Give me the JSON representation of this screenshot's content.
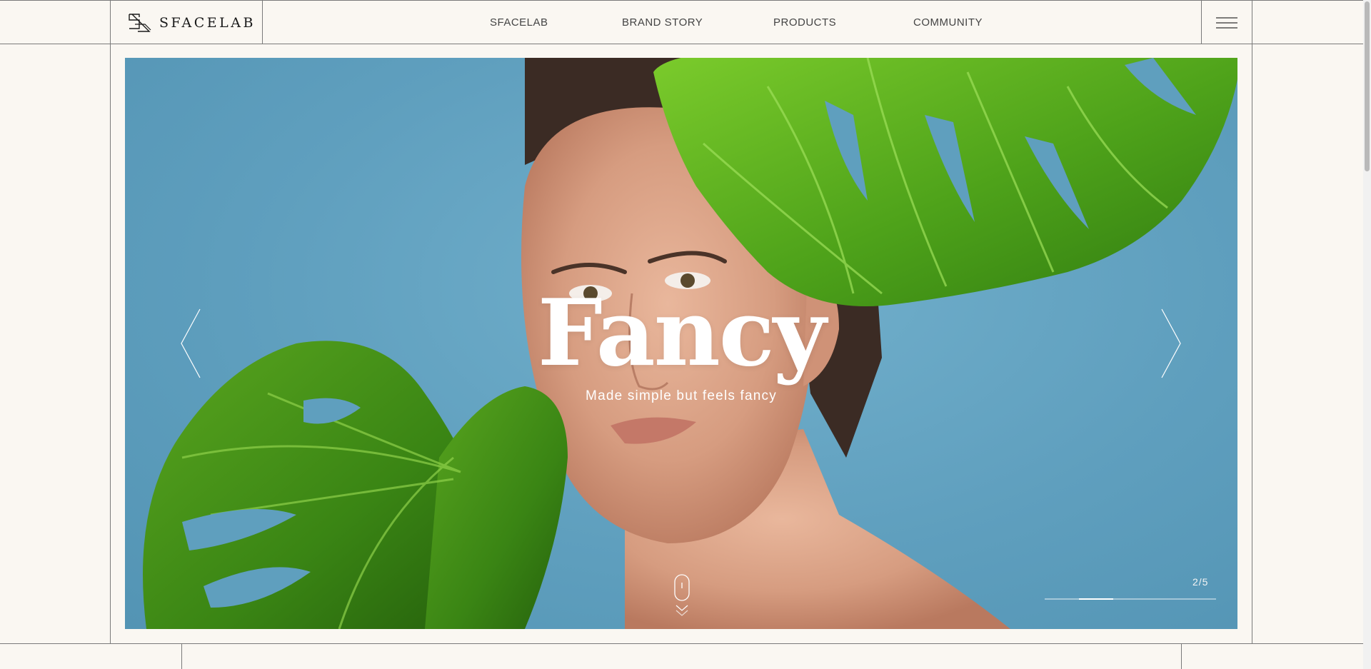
{
  "brand": {
    "logo_text": "SFACELAB"
  },
  "nav": {
    "items": [
      {
        "label": "SFACELAB"
      },
      {
        "label": "BRAND STORY"
      },
      {
        "label": "PRODUCTS"
      },
      {
        "label": "COMMUNITY"
      }
    ]
  },
  "hero": {
    "title": "Fancy",
    "subtitle": "Made simple but feels fancy",
    "slide_counter": "2/5",
    "slide_current": 2,
    "slide_total": 5
  },
  "colors": {
    "background": "#faf7f2",
    "hero_sky": "#5f9fbe",
    "leaf": "#3f9a1c",
    "line": "#7a7a7a"
  },
  "icons": {
    "logo": "sf-monogram-icon",
    "menu": "hamburger-icon",
    "prev": "chevron-left-icon",
    "next": "chevron-right-icon",
    "scroll": "mouse-scroll-icon"
  }
}
